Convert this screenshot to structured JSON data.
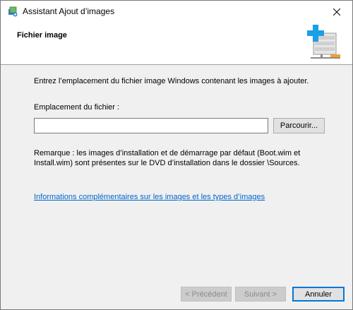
{
  "window": {
    "title": "Assistant Ajout d’images",
    "close_icon": "close-icon",
    "app_icon": "wds-images-icon"
  },
  "header": {
    "title": "Fichier image",
    "icon": "add-image-server-icon"
  },
  "content": {
    "instruction": "Entrez l’emplacement du fichier image Windows contenant les images à ajouter.",
    "location_label": "Emplacement du fichier :",
    "location_value": "",
    "browse_label": "Parcourir...",
    "remark_line1": "Remarque : les images d’installation et de démarrage par défaut (Boot.wim et",
    "remark_line2": "Install.wim) sont présentes sur le DVD d’installation dans le dossier \\Sources.",
    "info_link": "Informations complémentaires sur les images et les types d’images"
  },
  "footer": {
    "prev_label": "< Précédent",
    "next_label": "Suivant >",
    "cancel_label": "Annuler"
  },
  "colors": {
    "link": "#0066cc",
    "accent_border": "#0078d7",
    "plus": "#1aa0e6"
  }
}
